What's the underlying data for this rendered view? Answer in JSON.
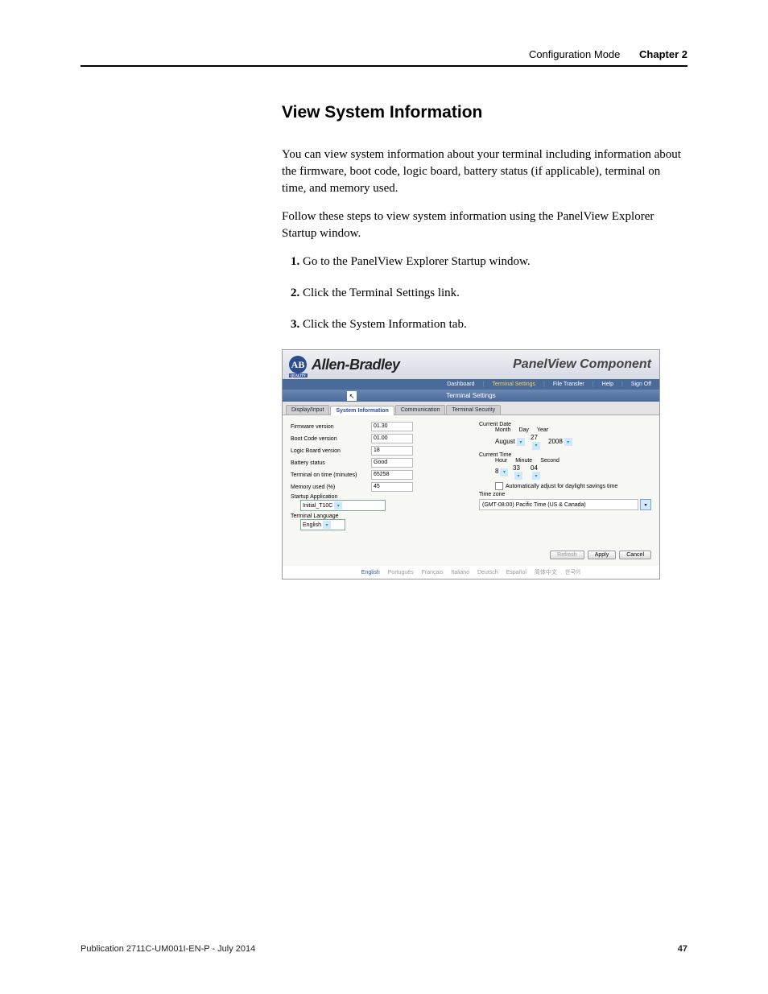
{
  "header": {
    "mode": "Configuration Mode",
    "chapter": "Chapter 2"
  },
  "section_title": "View System Information",
  "para1": "You can view system information about your terminal including information about the firmware, boot code, logic board, battery status (if applicable), terminal on time, and memory used.",
  "para2": "Follow these steps to view system information using the PanelView Explorer Startup window.",
  "steps": [
    "Go to the PanelView Explorer Startup window.",
    "Click the Terminal Settings link.",
    "Click the System Information tab."
  ],
  "screenshot": {
    "logo_letters": "AB",
    "logo_sub": "QUALITY",
    "brand": "Allen-Bradley",
    "product": "PanelView Component",
    "nav": [
      "Dashboard",
      "Terminal Settings",
      "File Transfer",
      "Help",
      "Sign Off"
    ],
    "nav_active_index": 1,
    "subbar_title": "Terminal Settings",
    "cursor_glyph": "↖",
    "tabs": [
      "Display/Input",
      "System Information",
      "Communication",
      "Terminal Security"
    ],
    "tab_active_index": 1,
    "left_fields": [
      {
        "label": "Firmware version",
        "value": "01.30"
      },
      {
        "label": "Boot Code version",
        "value": "01.00"
      },
      {
        "label": "Logic Board version",
        "value": "18"
      },
      {
        "label": "Battery status",
        "value": "Good"
      },
      {
        "label": "Terminal on time (minutes)",
        "value": "65258"
      },
      {
        "label": "Memory used (%)",
        "value": "45"
      }
    ],
    "startup_app_label": "Startup Application",
    "startup_app_value": "Initial_T10C",
    "term_lang_label": "Terminal Language",
    "term_lang_value": "English",
    "right": {
      "current_date_label": "Current Date",
      "date_cols": [
        "Month",
        "Day",
        "Year"
      ],
      "date_vals": [
        "August",
        "27",
        "2008"
      ],
      "current_time_label": "Current Time",
      "time_cols": [
        "Hour",
        "Minute",
        "Second"
      ],
      "time_vals": [
        "8",
        "33",
        "04"
      ],
      "dst_label": "Automatically adjust for daylight savings time",
      "tz_label": "Time zone",
      "tz_value": "(GMT-08:00) Pacific Time (US & Canada)"
    },
    "buttons": {
      "refresh": "Refresh",
      "apply": "Apply",
      "cancel": "Cancel"
    },
    "footer_langs": [
      "English",
      "Português",
      "Français",
      "Italiano",
      "Deutsch",
      "Español",
      "简体中文",
      "한국어"
    ]
  },
  "footer": {
    "publication": "Publication 2711C-UM001I-EN-P - July 2014",
    "page": "47"
  }
}
